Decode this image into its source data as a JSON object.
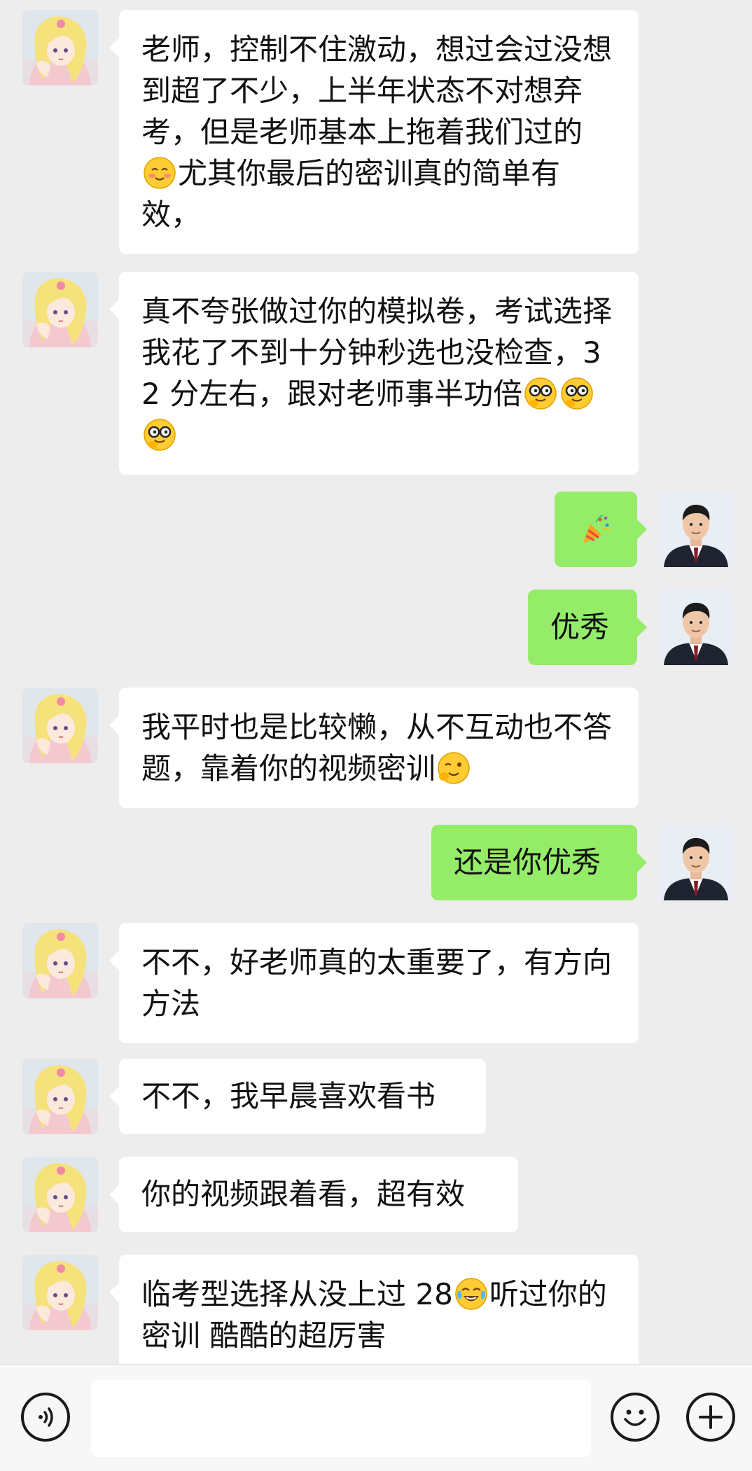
{
  "messages": [
    {
      "side": "in",
      "parts": [
        "老师，控制不住激动，想过会过没想到超了不少，上半年状态不对想弃考，但是老师基本上拖着我们过的",
        "尤其你最后的密训真的简单有效，"
      ],
      "emojis": [
        "blush-emoji"
      ]
    },
    {
      "side": "in",
      "parts": [
        "真不夸张做过你的模拟卷，考试选择我花了不到十分钟秒选也没检查，32 分左右，跟对老师事半功倍"
      ],
      "emojis": [
        "nerd-emoji",
        "nerd-emoji",
        "nerd-emoji"
      ]
    },
    {
      "side": "out",
      "parts": [
        ""
      ],
      "emojis": [
        "party-popper-emoji"
      ]
    },
    {
      "side": "out",
      "parts": [
        "优秀"
      ]
    },
    {
      "side": "in",
      "parts": [
        "我平时也是比较懒，从不互动也不答题，靠着你的视频密训"
      ],
      "emojis": [
        "wink-emoji"
      ]
    },
    {
      "side": "out",
      "parts": [
        "还是你优秀"
      ]
    },
    {
      "side": "in",
      "parts": [
        "不不，好老师真的太重要了，有方向方法"
      ]
    },
    {
      "side": "in",
      "parts": [
        "不不，我早晨喜欢看书"
      ]
    },
    {
      "side": "in",
      "parts": [
        "你的视频跟着看，超有效"
      ]
    },
    {
      "side": "in",
      "parts": [
        "临考型选择从没上过 28",
        "听过你的密训 酷酷的超厉害"
      ],
      "emojis": [
        "tears-of-joy-emoji"
      ]
    }
  ],
  "input": {
    "value": ""
  },
  "colors": {
    "background": "#ededed",
    "incoming_bubble": "#ffffff",
    "outgoing_bubble": "#95ec69",
    "text": "#111111"
  },
  "icons": {
    "voice": "voice-icon",
    "emoji": "emoji-icon",
    "add": "plus-icon"
  }
}
